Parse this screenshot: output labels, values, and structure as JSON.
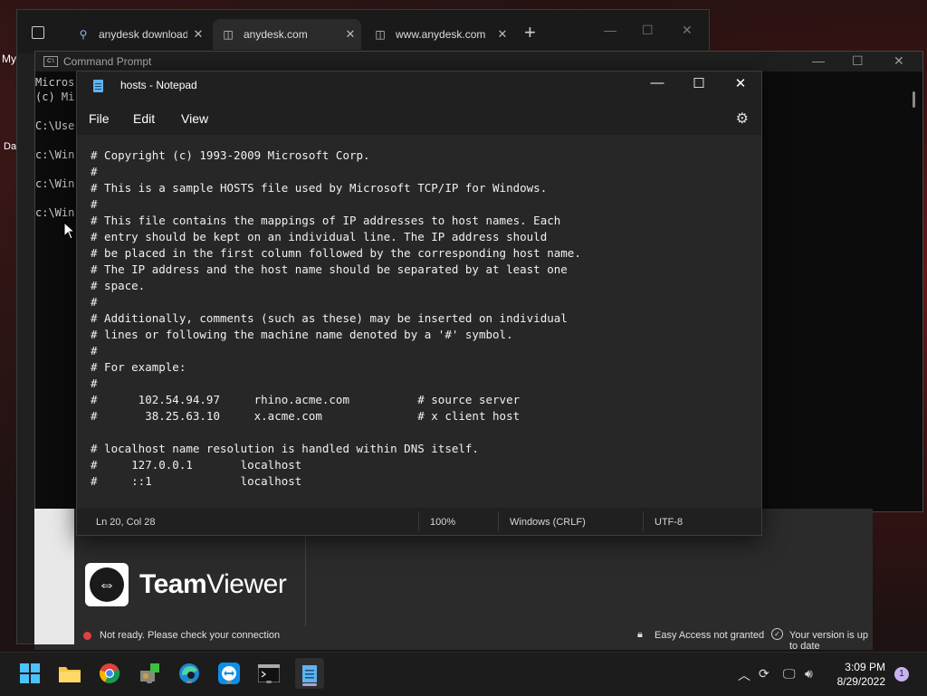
{
  "desktop": {
    "label_my": "My",
    "label_da": "Da"
  },
  "browser": {
    "tabs": [
      {
        "label": "anydesk download",
        "icon": "search-icon"
      },
      {
        "label": "anydesk.com",
        "icon": "page-icon"
      },
      {
        "label": "www.anydesk.com",
        "icon": "page-icon"
      }
    ],
    "new_tab": "+"
  },
  "cmd": {
    "title": "Command Prompt",
    "lines": [
      "Micros",
      "(c) Mi",
      "",
      "C:\\Use",
      "",
      "c:\\Win",
      "",
      "c:\\Win",
      "",
      "c:\\Win"
    ]
  },
  "notepad": {
    "title": "hosts - Notepad",
    "menu": {
      "file": "File",
      "edit": "Edit",
      "view": "View"
    },
    "content": "# Copyright (c) 1993-2009 Microsoft Corp.\n#\n# This is a sample HOSTS file used by Microsoft TCP/IP for Windows.\n#\n# This file contains the mappings of IP addresses to host names. Each\n# entry should be kept on an individual line. The IP address should\n# be placed in the first column followed by the corresponding host name.\n# The IP address and the host name should be separated by at least one\n# space.\n#\n# Additionally, comments (such as these) may be inserted on individual\n# lines or following the machine name denoted by a '#' symbol.\n#\n# For example:\n#\n#      102.54.94.97     rhino.acme.com          # source server\n#       38.25.63.10     x.acme.com              # x client host\n\n# localhost name resolution is handled within DNS itself.\n#     127.0.0.1       localhost\n#     ::1             localhost",
    "status": {
      "position": "Ln 20, Col 28",
      "zoom": "100%",
      "line_ending": "Windows (CRLF)",
      "encoding": "UTF-8"
    }
  },
  "teamviewer": {
    "brand_bold": "Team",
    "brand_light": "Viewer",
    "status_text": "Not ready. Please check your connection",
    "easy_access": "Easy Access not granted",
    "version": "Your version is up to date",
    "status_color": "#e04040"
  },
  "taskbar": {
    "time": "3:09 PM",
    "date": "8/29/2022",
    "notifications": "1"
  }
}
